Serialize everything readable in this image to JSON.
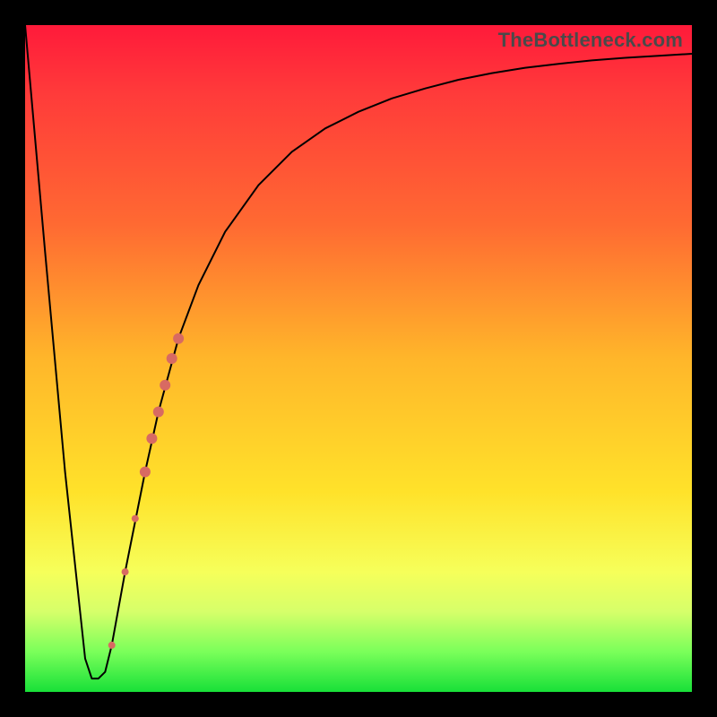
{
  "watermark": {
    "text": "TheBottleneck.com"
  },
  "chart_data": {
    "type": "line",
    "title": "",
    "xlabel": "",
    "ylabel": "",
    "xlim": [
      0,
      100
    ],
    "ylim": [
      0,
      100
    ],
    "series": [
      {
        "name": "curve",
        "x": [
          0,
          3,
          6,
          9,
          10,
          11,
          12,
          13,
          15,
          18,
          20,
          23,
          26,
          30,
          35,
          40,
          45,
          50,
          55,
          60,
          65,
          70,
          75,
          80,
          85,
          90,
          95,
          100
        ],
        "y": [
          100,
          66,
          33,
          5,
          2,
          2,
          3,
          7,
          18,
          33,
          42,
          53,
          61,
          69,
          76,
          81,
          84.5,
          87,
          89,
          90.5,
          91.8,
          92.8,
          93.6,
          94.2,
          94.7,
          95.1,
          95.4,
          95.7
        ]
      }
    ],
    "markers": {
      "name": "highlight-dots",
      "color": "#d86a62",
      "points": [
        {
          "x": 13.0,
          "y": 7,
          "r": 4
        },
        {
          "x": 15.0,
          "y": 18,
          "r": 4
        },
        {
          "x": 16.5,
          "y": 26,
          "r": 4
        },
        {
          "x": 18.0,
          "y": 33,
          "r": 6
        },
        {
          "x": 19.0,
          "y": 38,
          "r": 6
        },
        {
          "x": 20.0,
          "y": 42,
          "r": 6
        },
        {
          "x": 21.0,
          "y": 46,
          "r": 6
        },
        {
          "x": 22.0,
          "y": 50,
          "r": 6
        },
        {
          "x": 23.0,
          "y": 53,
          "r": 6
        }
      ]
    }
  }
}
